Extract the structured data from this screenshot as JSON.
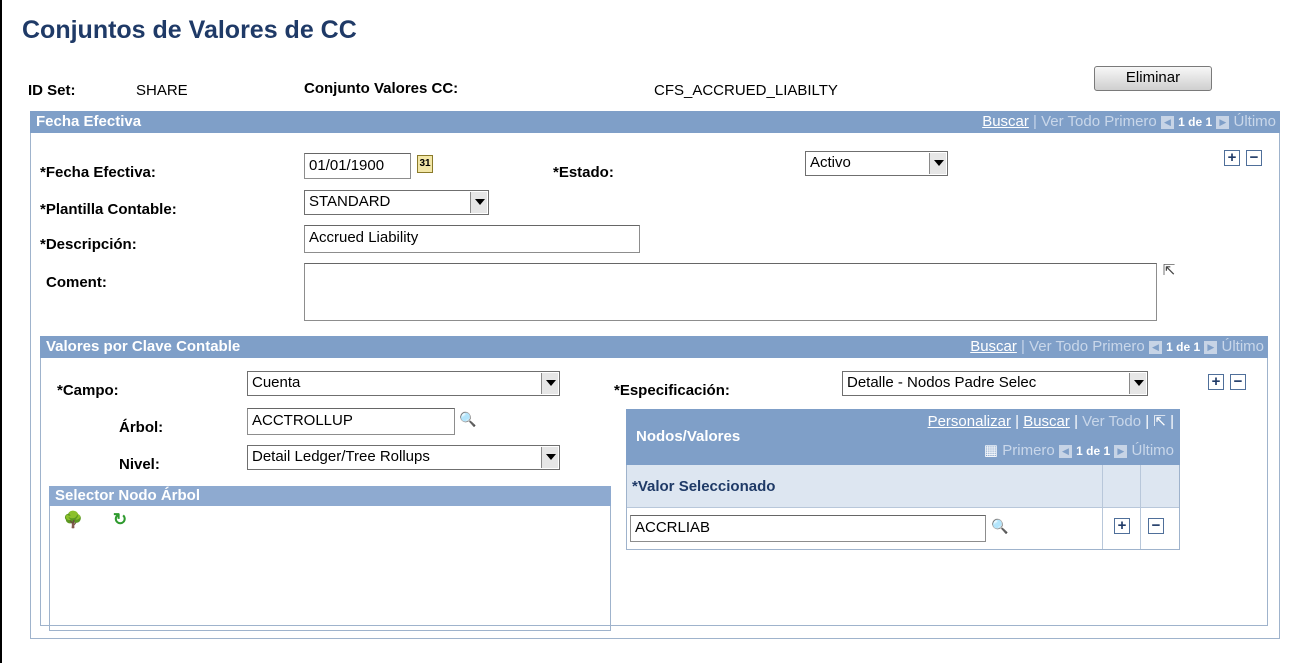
{
  "page_title": "Conjuntos de Valores de CC",
  "top": {
    "id_set_label": "ID Set:",
    "id_set_value": "SHARE",
    "conjunto_label": "Conjunto Valores CC:",
    "conjunto_value": "CFS_ACCRUED_LIABILTY",
    "delete_button": "Eliminar"
  },
  "fecha_section": {
    "header": "Fecha Efectiva",
    "nav": {
      "find": "Buscar",
      "sep": "|",
      "view_all": "Ver Todo",
      "first": "Primero",
      "count": "1 de 1",
      "last": "Último"
    },
    "fecha_label": "*Fecha Efectiva:",
    "fecha_value": "01/01/1900",
    "estado_label": "*Estado:",
    "estado_value": "Activo",
    "plantilla_label": "*Plantilla Contable:",
    "plantilla_value": "STANDARD",
    "descripcion_label": "*Descripción:",
    "descripcion_value": "Accrued Liability",
    "coment_label": "Coment:",
    "coment_value": ""
  },
  "valores_section": {
    "header": "Valores por Clave Contable",
    "nav": {
      "find": "Buscar",
      "sep": "|",
      "view_all": "Ver Todo",
      "first": "Primero",
      "count": "1 de 1",
      "last": "Último"
    },
    "campo_label": "*Campo:",
    "campo_value": "Cuenta",
    "especificacion_label": "*Especificación:",
    "especificacion_value": "Detalle - Nodos Padre Selec",
    "arbol_label": "Árbol:",
    "arbol_value": "ACCTROLLUP",
    "nivel_label": "Nivel:",
    "nivel_value": "Detail Ledger/Tree Rollups"
  },
  "selector": {
    "header": "Selector Nodo Árbol"
  },
  "nodos": {
    "header": "Nodos/Valores",
    "personalizar": "Personalizar",
    "find": "Buscar",
    "sep": "|",
    "view_all": "Ver Todo",
    "first": "Primero",
    "count": "1 de 1",
    "last": "Último",
    "column_header": "*Valor Seleccionado",
    "row_value": "ACCRLIAB"
  },
  "icons": {
    "plus": "+",
    "minus": "−",
    "calendar": "31",
    "search": "🔍",
    "expand": "⇱",
    "tree": "🌳",
    "refresh": "↻",
    "grid": "▦",
    "prev": "◀",
    "next": "▶"
  }
}
